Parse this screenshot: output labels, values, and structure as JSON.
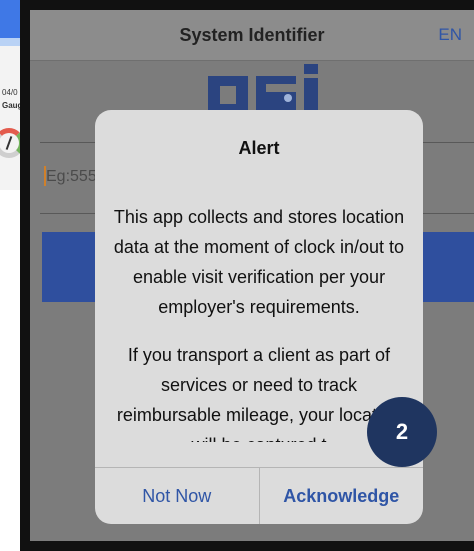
{
  "background_app": {
    "date_fragment": "04/0",
    "gauge_fragment": "Gaug"
  },
  "navbar": {
    "title": "System Identifier",
    "language": "EN"
  },
  "form": {
    "id_placeholder": "Eg:555"
  },
  "alert": {
    "title": "Alert",
    "paragraphs": [
      "This app collects and stores location data at the moment of clock in/out to enable visit verification per your employer's requirements.",
      "If you transport a client as part of services or need to track reimbursable mileage, your location will be captured t"
    ],
    "not_now_label": "Not Now",
    "acknowledge_label": "Acknowledge"
  },
  "step_badge": {
    "number": "2",
    "color": "#1f3560"
  },
  "colors": {
    "link_blue": "#2f55a6",
    "primary_button": "#2f4f9e"
  }
}
